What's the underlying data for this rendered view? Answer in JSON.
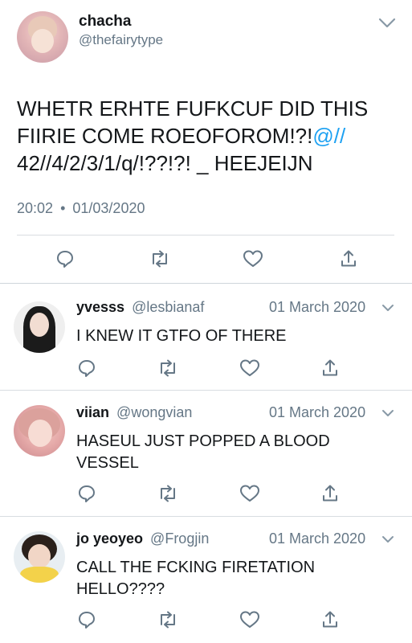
{
  "main_tweet": {
    "display_name": "chacha",
    "handle": "@thefairytype",
    "text_line1": "WHETR ERHTE FUFKCUF DID THIS",
    "text_line2_pre": "FIIRIE COME ROEOFOROM!?!",
    "text_line2_link": "@//",
    "text_line3": "42//4/2/3/1/q/!??!?! _ HEEJEIJN",
    "time": "20:02",
    "separator": "•",
    "date": "01/03/2020"
  },
  "replies": [
    {
      "display_name": "yvesss",
      "handle": "@lesbianaf",
      "date": "01 March 2020",
      "text_line1": "I KNEW IT GTFO OF THERE",
      "text_line2": ""
    },
    {
      "display_name": "viian",
      "handle": "@wongvian",
      "date": "01 March 2020",
      "text_line1": "HASEUL JUST POPPED A BLOOD",
      "text_line2": "VESSEL"
    },
    {
      "display_name": "jo yeoyeo",
      "handle": "@Frogjin",
      "date": "01 March 2020",
      "text_line1": "CALL THE FCKING FIRETATION",
      "text_line2": "HELLO????"
    }
  ],
  "icons": {
    "reply": "reply-icon",
    "retweet": "retweet-icon",
    "like": "like-icon",
    "share": "share-icon",
    "chevron": "chevron-down-icon"
  },
  "colors": {
    "link": "#1da1f2",
    "gray": "#657786",
    "text": "#14171a"
  }
}
